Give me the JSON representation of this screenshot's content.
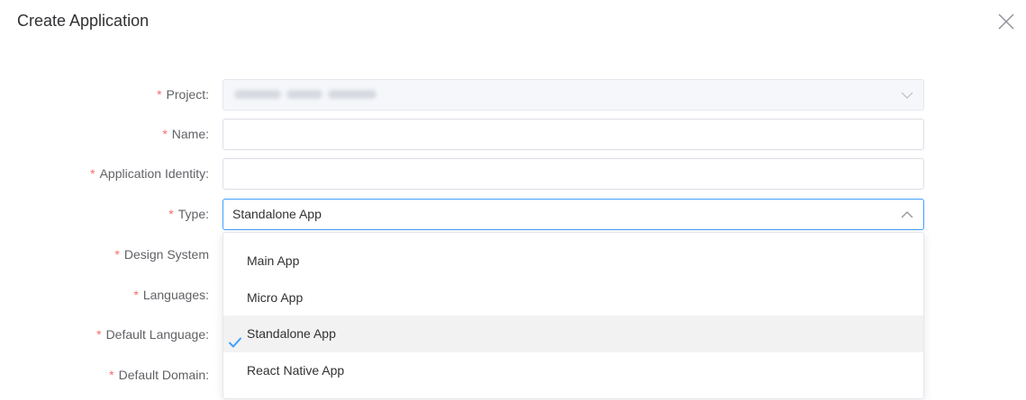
{
  "dialog": {
    "title": "Create Application"
  },
  "form": {
    "required_mark": "*",
    "project": {
      "label": "Project:"
    },
    "name": {
      "label": "Name:",
      "value": ""
    },
    "application_identity": {
      "label": "Application Identity:",
      "value": ""
    },
    "type": {
      "label": "Type:",
      "value": "Standalone App"
    },
    "design_system": {
      "label": "Design System"
    },
    "languages": {
      "label": "Languages:"
    },
    "default_language": {
      "label": "Default Language:"
    },
    "default_domain": {
      "label": "Default Domain:"
    }
  },
  "type_dropdown": {
    "options": [
      {
        "label": "Main App",
        "selected": false
      },
      {
        "label": "Micro App",
        "selected": false
      },
      {
        "label": "Standalone App",
        "selected": true
      },
      {
        "label": "React Native App",
        "selected": false
      }
    ]
  },
  "colors": {
    "required": "#f56c6c",
    "focus_border": "#409eff",
    "check": "#409eff",
    "selected_bg": "#f2f2f2"
  },
  "icons": {
    "close": "close-icon",
    "arrow_down": "chevron-down-icon",
    "arrow_up": "chevron-up-icon",
    "check": "check-icon"
  }
}
